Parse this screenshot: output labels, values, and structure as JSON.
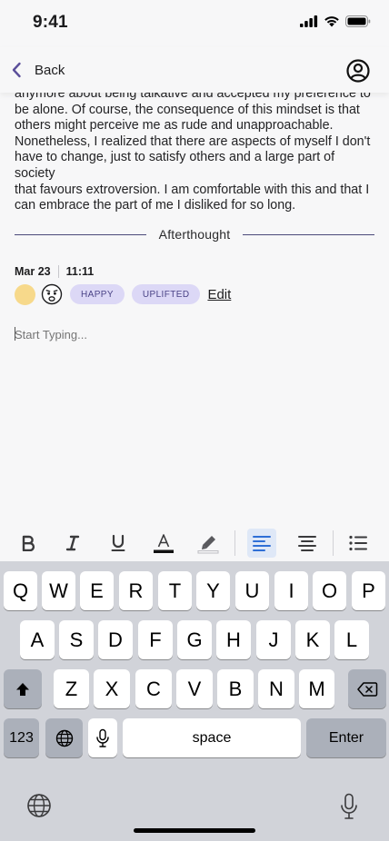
{
  "status_bar": {
    "time": "9:41"
  },
  "nav": {
    "back_label": "Back"
  },
  "entry": {
    "body_lines": [
      "anymore about being talkative and accepted my preference to",
      "be alone. Of course, the consequence of this mindset is that",
      "others might perceive me as rude and unapproachable.",
      "Nonetheless, I realized that there are aspects of myself I don't",
      "have to change, just to satisfy others and a large part of society",
      "that favours extroversion. I am comfortable with this and that I",
      "can embrace the part of me I disliked for so long."
    ]
  },
  "afterthought": {
    "divider_label": "Afterthought",
    "date": "Mar 23",
    "time": "11:11",
    "mood_color": "#f7d98b",
    "mood_face_icon": "worried-face-icon",
    "tags": [
      "HAPPY",
      "UPLIFTED"
    ],
    "edit_label": "Edit",
    "placeholder": "Start Typing..."
  },
  "toolbar": {
    "bold_icon": "bold-icon",
    "italic_icon": "italic-icon",
    "underline_icon": "underline-icon",
    "text_color_icon": "text-color-icon",
    "highlight_icon": "highlight-icon",
    "align_left_icon": "align-left-icon",
    "align_center_icon": "align-center-icon",
    "list_icon": "list-icon",
    "active_color": "#2f6fd6"
  },
  "keyboard": {
    "row1": [
      "Q",
      "W",
      "E",
      "R",
      "T",
      "Y",
      "U",
      "I",
      "O",
      "P"
    ],
    "row2": [
      "A",
      "S",
      "D",
      "F",
      "G",
      "H",
      "J",
      "K",
      "L"
    ],
    "row3": [
      "Z",
      "X",
      "C",
      "V",
      "B",
      "N",
      "M"
    ],
    "numbers_label": "123",
    "space_label": "space",
    "enter_label": "Enter"
  }
}
